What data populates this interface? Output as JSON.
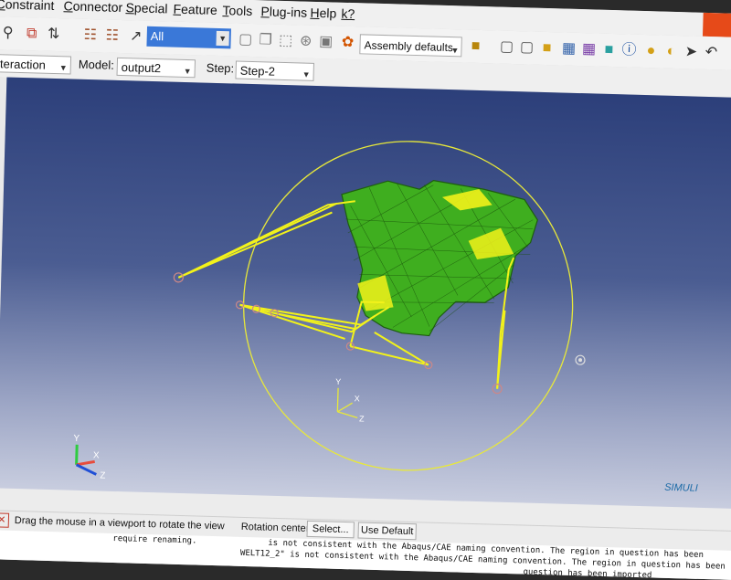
{
  "menu": {
    "items": [
      "Constraint",
      "Connector",
      "Special",
      "Feature",
      "Tools",
      "Plug-ins",
      "Help",
      "k?"
    ]
  },
  "toolbar": {
    "selection_filter": "All",
    "render_style": "Assembly defaults"
  },
  "context": {
    "module_value": "nteraction",
    "model_label": "Model:",
    "model_value": "output2",
    "step_label": "Step:",
    "step_value": "Step-2"
  },
  "viewport": {
    "triad": {
      "x": "X",
      "y": "Y",
      "z": "Z"
    },
    "local_triad": {
      "x": "X",
      "y": "Y",
      "z": "Z"
    },
    "logo": "SIMULI"
  },
  "prompt": {
    "instruction": "Drag the mouse in a viewport to rotate the view",
    "rotation_center_label": "Rotation center:",
    "select_button": "Select...",
    "default_button": "Use Default"
  },
  "messages": {
    "line1": "is not consistent with the Abaqus/CAE naming convention. The region in question has been",
    "line1_prefix": "require renaming.",
    "line2": "WELT12_2\" is not consistent with the Abaqus/CAE naming convention. The region in question has been",
    "line3": "question has been imported"
  },
  "colors": {
    "menu_accent": "#e64a19",
    "selection_highlight": "#3a78d8",
    "viewport_top": "#2c3f7a",
    "viewport_bottom": "#c8cddf",
    "mesh_green": "#3fae1f",
    "coupling_yellow": "#f2f21a"
  }
}
